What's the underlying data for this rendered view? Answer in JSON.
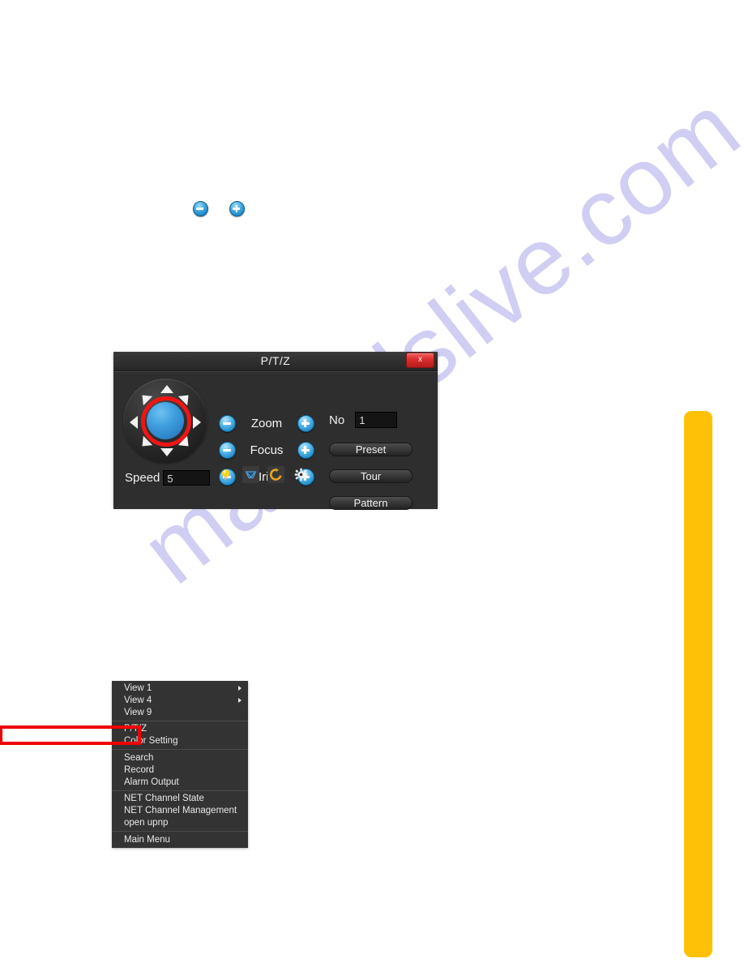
{
  "page": {
    "background_color": "#ffffff",
    "watermark_text": "manualslive.com",
    "watermark_color": "#cfccf4"
  },
  "top_icons": {
    "zoom_out": {
      "name": "zoom-out-icon",
      "glyph": "minus"
    },
    "zoom_in": {
      "name": "zoom-in-icon",
      "glyph": "plus"
    }
  },
  "ptz_dialog": {
    "title": "P/T/Z",
    "close_label": "x",
    "close_color": "#d92b2b",
    "dpad": {
      "ring_color": "#f01515",
      "center_color": "#3f9ede",
      "directions": [
        "up",
        "up-right",
        "right",
        "down-right",
        "down",
        "down-left",
        "left",
        "up-left"
      ]
    },
    "speed": {
      "label": "Speed",
      "value": "5"
    },
    "controls": [
      {
        "label": "Zoom",
        "minus": "−",
        "plus": "+"
      },
      {
        "label": "Focus",
        "minus": "−",
        "plus": "+"
      },
      {
        "label": "Iris",
        "minus": "−",
        "plus": "+"
      }
    ],
    "icon_strip": [
      {
        "name": "light-bulb-icon",
        "color": "#f7d117"
      },
      {
        "name": "wiper-icon",
        "color": "#2f7fc0"
      },
      {
        "name": "flip-rotate-icon",
        "color": "#e0a020"
      },
      {
        "name": "gear-icon",
        "color": "#e8e8e8"
      }
    ],
    "preset_no": {
      "label": "No",
      "value": "1"
    },
    "buttons": [
      {
        "label": "Preset"
      },
      {
        "label": "Tour"
      },
      {
        "label": "Pattern"
      }
    ]
  },
  "context_menu": {
    "highlight_color": "#f00000",
    "highlighted_item": "Color Setting",
    "groups": [
      [
        {
          "label": "View 1",
          "submenu": true
        },
        {
          "label": "View 4",
          "submenu": true
        },
        {
          "label": "View 9",
          "submenu": false
        }
      ],
      [
        {
          "label": "P/T/Z",
          "submenu": false
        },
        {
          "label": "Color Setting",
          "submenu": false
        }
      ],
      [
        {
          "label": "Search",
          "submenu": false
        },
        {
          "label": "Record",
          "submenu": false
        },
        {
          "label": "Alarm Output",
          "submenu": false
        }
      ],
      [
        {
          "label": "NET Channel State",
          "submenu": false
        },
        {
          "label": "NET Channel Management",
          "submenu": false
        },
        {
          "label": "open upnp",
          "submenu": false
        }
      ],
      [
        {
          "label": "Main Menu",
          "submenu": false
        }
      ]
    ]
  },
  "side_bar": {
    "color": "#ffc107"
  }
}
